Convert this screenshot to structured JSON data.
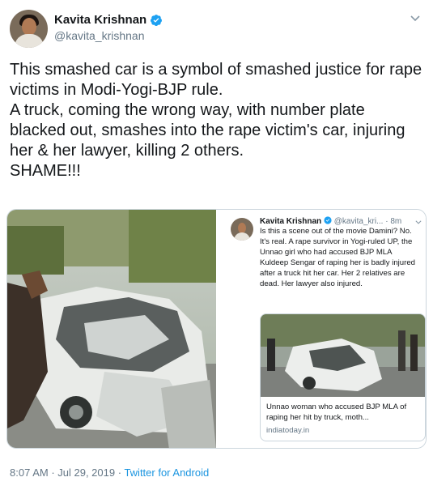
{
  "author": {
    "display_name": "Kavita Krishnan",
    "handle": "@kavita_krishnan",
    "verified": true
  },
  "tweet": {
    "lines": [
      "This smashed car is a symbol of smashed justice for rape victims in Modi-Yogi-BJP rule.",
      "A truck, coming the wrong way, with number plate blacked out, smashes into the rape victim's car, injuring her & her lawyer, killing 2 others.",
      "SHAME!!!"
    ]
  },
  "embedded_tweet": {
    "display_name": "Kavita Krishnan",
    "handle": "@kavita_kri...",
    "time_ago": "8m",
    "text": "Is this a scene out of the movie Damini? No. It's real. A rape survivor in Yogi-ruled UP, the Unnao girl who had accused BJP MLA Kuldeep Sengar of raping her is badly injured after a truck hit her car. Her 2 relatives are dead. Her lawyer also injured.",
    "card": {
      "title": "Unnao woman who accused BJP MLA of raping her hit by truck, moth...",
      "domain": "indiatoday.in"
    }
  },
  "meta": {
    "time": "8:07 AM",
    "date": "Jul 29, 2019",
    "separator": " · ",
    "source": "Twitter for Android"
  },
  "colors": {
    "text_primary": "#14171a",
    "text_secondary": "#657786",
    "link": "#1b95e0",
    "verified": "#1da1f2",
    "border": "#ccd6dd"
  }
}
